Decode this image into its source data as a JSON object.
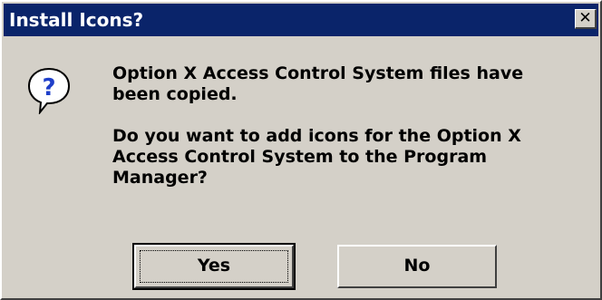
{
  "window": {
    "title": "Install Icons?",
    "close_glyph": "✕"
  },
  "icon": {
    "name": "question-icon",
    "glyph": "?",
    "color": "#1f3fc9"
  },
  "message": {
    "line1": "Option X Access Control System files have\nbeen copied.",
    "line2": "Do you want to add icons for the Option X\nAccess Control System to the Program\nManager?"
  },
  "buttons": {
    "yes_label": "Yes",
    "no_label": "No"
  },
  "colors": {
    "titlebar": "#0a246a",
    "face": "#d4d0c8"
  }
}
